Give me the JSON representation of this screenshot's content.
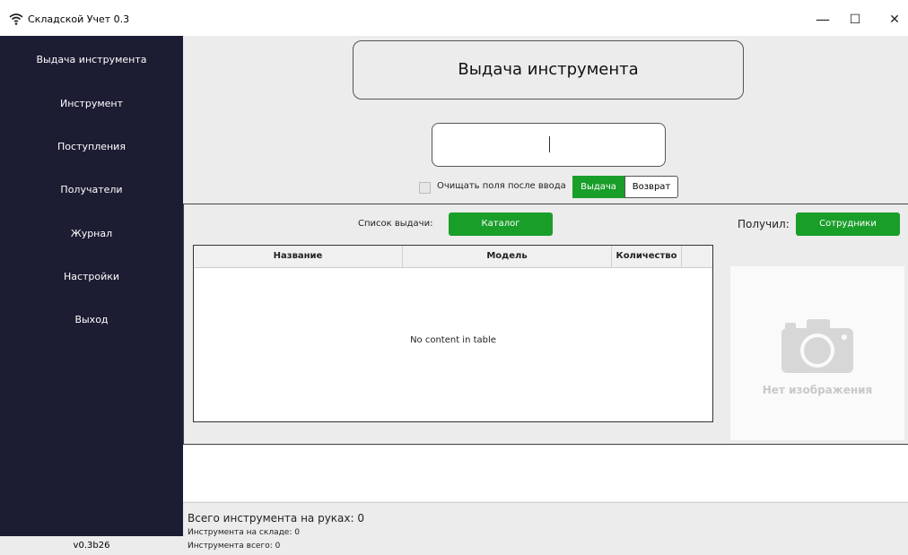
{
  "window": {
    "title": "Складской Учет 0.3",
    "minimize": "—",
    "maximize": "☐",
    "close": "✕"
  },
  "sidebar": {
    "items": [
      {
        "label": "Выдача инструмента"
      },
      {
        "label": "Инструмент"
      },
      {
        "label": "Поступления"
      },
      {
        "label": "Получатели"
      },
      {
        "label": "Журнал"
      },
      {
        "label": "Настройки"
      },
      {
        "label": "Выход"
      }
    ],
    "version": "v0.3b26"
  },
  "main": {
    "title": "Выдача инструмента",
    "scan_input_value": "",
    "clear_fields_label": "Очищать поля после ввода",
    "clear_fields_checked": false,
    "mode_issue_label": "Выдача",
    "mode_return_label": "Возврат",
    "list_label": "Список выдачи:",
    "catalog_button": "Каталог",
    "received_label": "Получил:",
    "staff_button": "Сотрудники",
    "table": {
      "columns": [
        "Название",
        "Модель",
        "Количество"
      ],
      "empty_text": "No content in table"
    },
    "no_image_text": "Нет изображения"
  },
  "footer": {
    "on_hands": "Всего инструмента на руках: 0",
    "in_stock": "Инструмента на складе: 0",
    "total": "Инструмента всего: 0"
  },
  "colors": {
    "sidebar_bg": "#1c1c33",
    "accent_green": "#1a9e2a"
  }
}
